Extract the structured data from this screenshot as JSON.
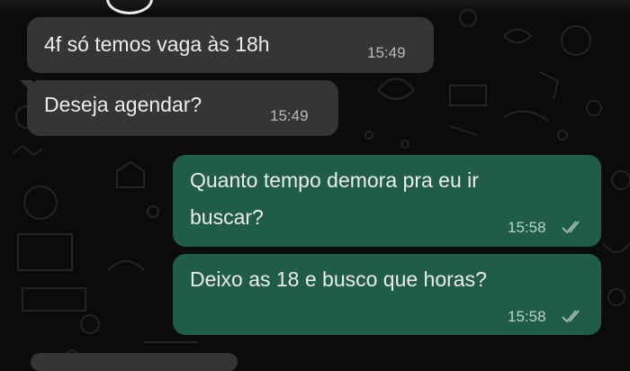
{
  "conversation": {
    "messages": [
      {
        "id": "m1",
        "direction": "incoming",
        "text": "4f só temos vaga às 18h",
        "time": "15:49"
      },
      {
        "id": "m2",
        "direction": "incoming",
        "text": "Deseja agendar?",
        "time": "15:49"
      },
      {
        "id": "m3",
        "direction": "outgoing",
        "text_line1": "Quanto tempo demora pra eu ir",
        "text_line2": "buscar?",
        "time": "15:58",
        "status": "read"
      },
      {
        "id": "m4",
        "direction": "outgoing",
        "text": "Deixo as 18 e busco que horas?",
        "time": "15:58",
        "status": "read"
      }
    ]
  },
  "colors": {
    "background": "#0b0b0b",
    "incoming_bubble": "#353535",
    "outgoing_bubble": "#1f5c4a",
    "read_ticks": "#9fb5ad"
  },
  "icons": [
    "double-check-icon"
  ]
}
